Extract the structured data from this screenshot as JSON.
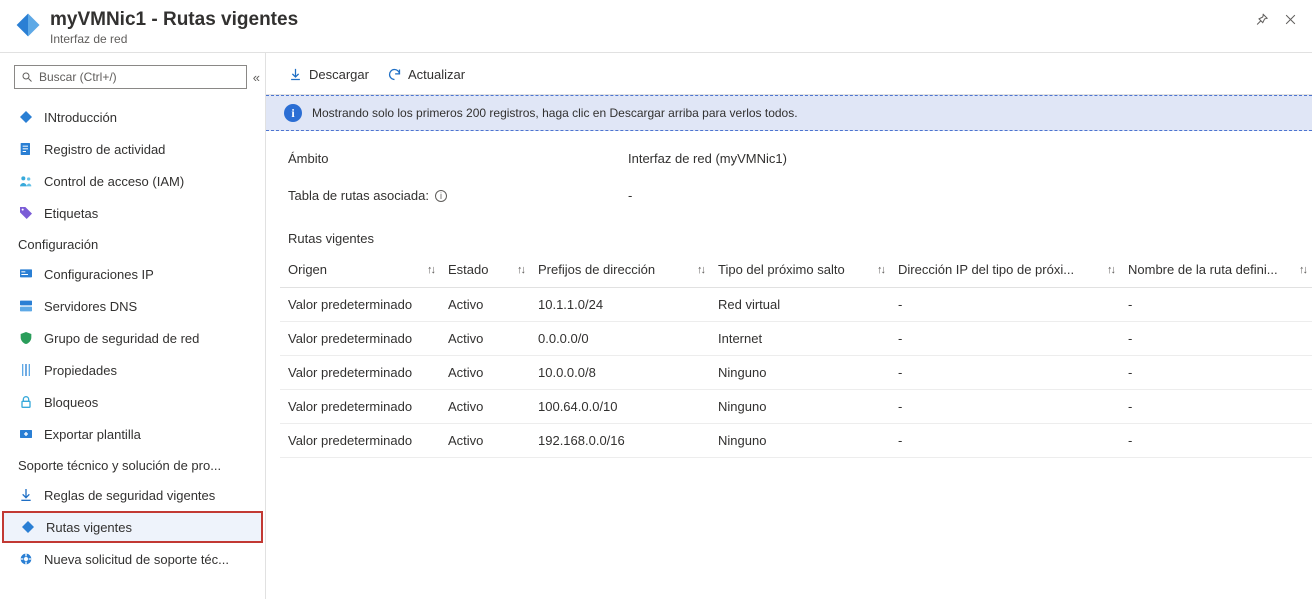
{
  "header": {
    "title": "myVMNic1 - Rutas vigentes",
    "subtitle": "Interfaz de red"
  },
  "search": {
    "placeholder": "Buscar (Ctrl+/)"
  },
  "sidebar": {
    "top_items": [
      {
        "label": "INtroducción",
        "icon": "nic"
      },
      {
        "label": "Registro de actividad",
        "icon": "log"
      },
      {
        "label": "Control de acceso (IAM)",
        "icon": "people"
      },
      {
        "label": "Etiquetas",
        "icon": "tag"
      }
    ],
    "group_config_title": "Configuración",
    "config_items": [
      {
        "label": "Configuraciones IP",
        "icon": "ipconfig"
      },
      {
        "label": "Servidores DNS",
        "icon": "dns"
      },
      {
        "label": "Grupo de seguridad de red",
        "icon": "shield"
      },
      {
        "label": "Propiedades",
        "icon": "props"
      },
      {
        "label": "Bloqueos",
        "icon": "lock"
      },
      {
        "label": "Exportar plantilla",
        "icon": "export"
      }
    ],
    "group_support_title": "Soporte técnico y solución de pro...",
    "support_items": [
      {
        "label": "Reglas de seguridad vigentes",
        "icon": "rules"
      },
      {
        "label": "Rutas vigentes",
        "icon": "routes",
        "selected": true
      },
      {
        "label": "Nueva solicitud de soporte téc...",
        "icon": "support"
      }
    ]
  },
  "toolbar": {
    "download": "Descargar",
    "refresh": "Actualizar"
  },
  "banner": {
    "text": "Mostrando solo los primeros 200 registros, haga clic en Descargar arriba para verlos todos."
  },
  "scope": {
    "label": "Ámbito",
    "value": "Interfaz de red (myVMNic1)",
    "route_table_label": "Tabla de rutas asociada:",
    "route_table_value": "-"
  },
  "table": {
    "title": "Rutas vigentes",
    "columns": [
      "Origen",
      "Estado",
      "Prefijos de dirección",
      "Tipo del próximo salto",
      "Dirección IP del tipo de próxi...",
      "Nombre de la ruta defini..."
    ],
    "rows": [
      {
        "origin": "Valor predeterminado",
        "state": "Activo",
        "prefix": "10.1.1.0/24",
        "hop": "Red virtual",
        "hopip": "-",
        "name": "-"
      },
      {
        "origin": "Valor predeterminado",
        "state": "Activo",
        "prefix": "0.0.0.0/0",
        "hop": "Internet",
        "hopip": "-",
        "name": "-"
      },
      {
        "origin": "Valor predeterminado",
        "state": "Activo",
        "prefix": "10.0.0.0/8",
        "hop": "Ninguno",
        "hopip": "-",
        "name": "-"
      },
      {
        "origin": "Valor predeterminado",
        "state": "Activo",
        "prefix": "100.64.0.0/10",
        "hop": "Ninguno",
        "hopip": "-",
        "name": "-"
      },
      {
        "origin": "Valor predeterminado",
        "state": "Activo",
        "prefix": "192.168.0.0/16",
        "hop": "Ninguno",
        "hopip": "-",
        "name": "-"
      }
    ]
  }
}
